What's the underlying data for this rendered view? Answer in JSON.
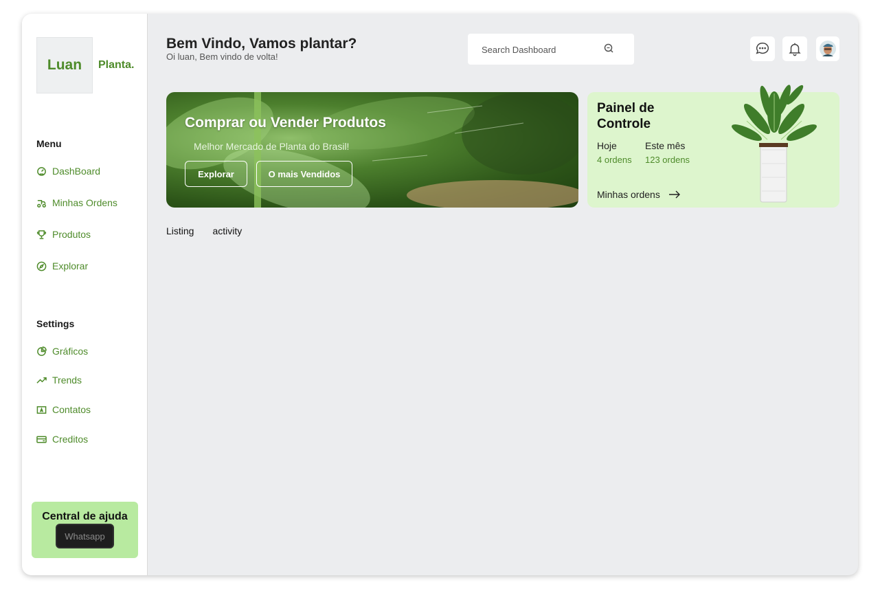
{
  "brand": {
    "logo_text": "Luan",
    "name": "Planta."
  },
  "sidebar": {
    "menu_title": "Menu",
    "menu_items": [
      {
        "label": "DashBoard",
        "icon": "dashboard-icon"
      },
      {
        "label": "Minhas Ordens",
        "icon": "orders-icon"
      },
      {
        "label": "Produtos",
        "icon": "trophy-icon"
      },
      {
        "label": "Explorar",
        "icon": "compass-icon"
      }
    ],
    "settings_title": "Settings",
    "settings_items": [
      {
        "label": "Gráficos",
        "icon": "pie-chart-icon"
      },
      {
        "label": "Trends",
        "icon": "trend-up-icon"
      },
      {
        "label": "Contatos",
        "icon": "contact-card-icon"
      },
      {
        "label": "Creditos",
        "icon": "credit-card-icon"
      }
    ],
    "help": {
      "title": "Central de ajuda",
      "button_label": "Whatsapp"
    }
  },
  "header": {
    "title": "Bem Vindo, Vamos plantar?",
    "subtitle": "Oi luan, Bem vindo de volta!",
    "search_placeholder": "Search Dashboard"
  },
  "banner": {
    "title": "Comprar ou Vender Produtos",
    "subtitle": "Melhor Mercado de Planta do Brasil!",
    "primary_button": "Explorar",
    "secondary_button": "O mais Vendidos"
  },
  "panel": {
    "title": "Painel de Controle",
    "stats": [
      {
        "label": "Hoje",
        "value": "4 ordens"
      },
      {
        "label": "Este mês",
        "value": "123 ordens"
      }
    ],
    "link_label": "Minhas ordens"
  },
  "tabs": [
    {
      "label": "Listing"
    },
    {
      "label": "activity"
    }
  ],
  "colors": {
    "accent": "#4e8b2a",
    "panel_bg": "#ddf5cd",
    "help_bg": "#b8eaa0",
    "page_bg": "#ecedef"
  }
}
